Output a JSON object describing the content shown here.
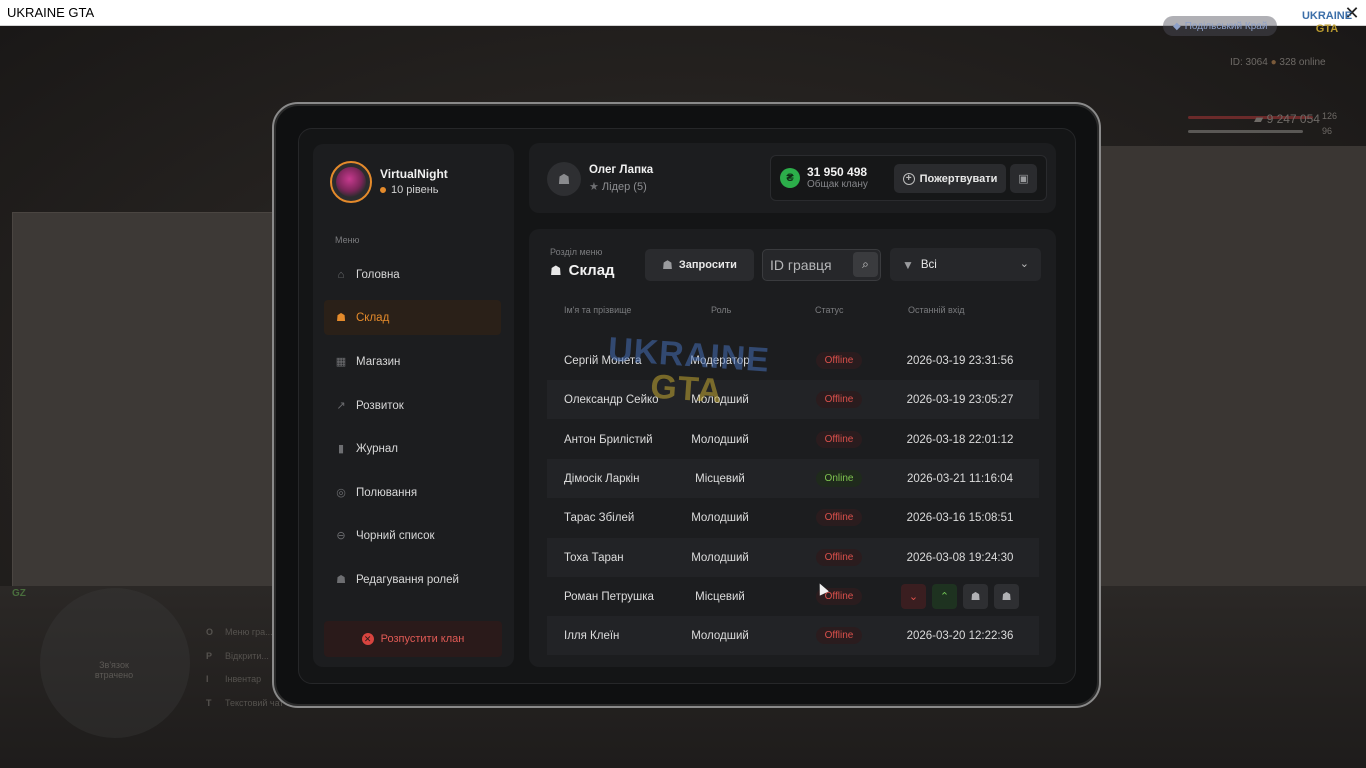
{
  "window": {
    "title": "UKRAINE GTA",
    "close": "✕"
  },
  "hud": {
    "server": "Подільський Край",
    "logo_line1": "UKRAINE",
    "logo_line2": "GTA",
    "id_text": "ID: 3064",
    "online_text": "328 online",
    "health": "126",
    "armor": "96",
    "money": "9 247 054",
    "gz": "GZ",
    "minimap_text": "Зв'язок втрачено",
    "keys": [
      {
        "key": "O",
        "label": "Меню гра..."
      },
      {
        "key": "P",
        "label": "Відкрити..."
      },
      {
        "key": "I",
        "label": "Інвентар"
      },
      {
        "key": "T",
        "label": "Текстовий чат"
      }
    ]
  },
  "user": {
    "name": "VirtualNight",
    "level": "10 рівень"
  },
  "menu": {
    "caption": "Меню",
    "items": [
      {
        "label": "Головна",
        "icon": "home-icon",
        "glyph": "⌂"
      },
      {
        "label": "Склад",
        "icon": "users-icon",
        "glyph": "☗",
        "active": true
      },
      {
        "label": "Магазин",
        "icon": "shop-icon",
        "glyph": "▦"
      },
      {
        "label": "Розвиток",
        "icon": "chart-icon",
        "glyph": "↗"
      },
      {
        "label": "Журнал",
        "icon": "book-icon",
        "glyph": "▮"
      },
      {
        "label": "Полювання",
        "icon": "target-icon",
        "glyph": "◎"
      },
      {
        "label": "Чорний список",
        "icon": "ban-icon",
        "glyph": "⊖"
      },
      {
        "label": "Редагування ролей",
        "icon": "user-edit-icon",
        "glyph": "☗"
      }
    ],
    "disband_label": "Розпустити клан"
  },
  "leader": {
    "name": "Олег Лапка",
    "role": "Лідер (5)"
  },
  "bank": {
    "coin": "₴",
    "amount": "31 950 498",
    "label": "Общак клану",
    "donate_label": "Пожертвувати"
  },
  "section": {
    "caption": "Розділ меню",
    "title": "Склад",
    "invite_label": "Запросити",
    "search_placeholder": "ID гравця",
    "filter_value": "Всі"
  },
  "table": {
    "columns": [
      "Ім'я та прізвище",
      "Роль",
      "Статус",
      "Останній вхід"
    ],
    "rows": [
      {
        "name": "Сергій Монета",
        "role": "Модератор",
        "status": "Offline",
        "last": "2026-03-19 23:31:56"
      },
      {
        "name": "Олександр Сейко",
        "role": "Молодший",
        "status": "Offline",
        "last": "2026-03-19 23:05:27"
      },
      {
        "name": "Антон Брилістий",
        "role": "Молодший",
        "status": "Offline",
        "last": "2026-03-18 22:01:12"
      },
      {
        "name": "Дімосік Ларкін",
        "role": "Місцевий",
        "status": "Online",
        "last": "2026-03-21 11:16:04"
      },
      {
        "name": "Тарас Збілей",
        "role": "Молодший",
        "status": "Offline",
        "last": "2026-03-16 15:08:51"
      },
      {
        "name": "Тоха Таран",
        "role": "Молодший",
        "status": "Offline",
        "last": "2026-03-08 19:24:30"
      },
      {
        "name": "Роман Петрушка",
        "role": "Місцевий",
        "status": "Offline",
        "last": ""
      },
      {
        "name": "Ілля Клеїн",
        "role": "Молодший",
        "status": "Offline",
        "last": "2026-03-20 12:22:36"
      }
    ]
  },
  "watermark": {
    "line1": "UKRAINE",
    "line2": "GTA"
  },
  "colors": {
    "accent": "#e48a2b",
    "offline": "#d9504b",
    "online": "#7ec24f",
    "coin": "#2cae4a"
  }
}
